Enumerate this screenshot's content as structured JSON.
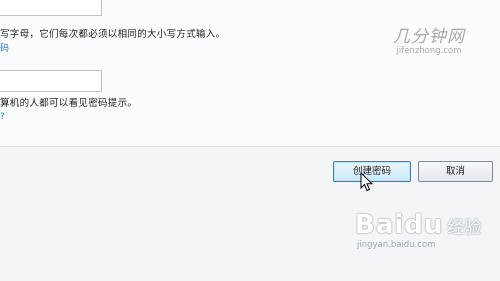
{
  "watermark_top": {
    "name": "几分钟网",
    "url": "jifenzhong.com"
  },
  "password_help": {
    "text": "写字母，它们每次都必须以相同的大小写方式输入。",
    "link": "码"
  },
  "hint_help": {
    "text": "算机的人都可以看见密码提示。",
    "link": "?"
  },
  "buttons": {
    "create_label": "创建密码",
    "cancel_label": "取消"
  },
  "watermark_bottom": {
    "logo": "Baidu",
    "cn": "经验",
    "url": "jingyan.baidu.com"
  }
}
